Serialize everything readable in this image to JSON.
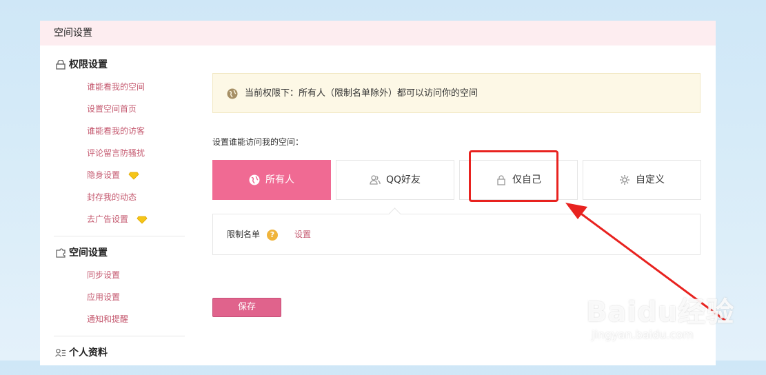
{
  "header": {
    "title": "空间设置"
  },
  "sidebar": {
    "groups": [
      {
        "title": "权限设置",
        "icon": "lock-icon",
        "items": [
          {
            "label": "谁能看我的空间"
          },
          {
            "label": "设置空间首页"
          },
          {
            "label": "谁能看我的访客"
          },
          {
            "label": "评论留言防骚扰"
          },
          {
            "label": "隐身设置",
            "badge_icon": "diamond-icon"
          },
          {
            "label": "封存我的动态"
          },
          {
            "label": "去广告设置",
            "badge_icon": "diamond-icon"
          }
        ]
      },
      {
        "title": "空间设置",
        "icon": "puzzle-icon",
        "items": [
          {
            "label": "同步设置"
          },
          {
            "label": "应用设置"
          },
          {
            "label": "通知和提醒"
          }
        ]
      },
      {
        "title": "个人资料",
        "icon": "profile-icon",
        "items": []
      }
    ]
  },
  "main": {
    "notice": "当前权限下：所有人（限制名单除外）都可以访问你的空间",
    "prompt": "设置谁能访问我的空间：",
    "options": [
      {
        "label": "所有人",
        "icon": "globe-icon",
        "selected": true
      },
      {
        "label": "QQ好友",
        "icon": "friends-icon",
        "selected": false
      },
      {
        "label": "仅自己",
        "icon": "lock-icon",
        "selected": false
      },
      {
        "label": "自定义",
        "icon": "gear-icon",
        "selected": false
      }
    ],
    "limit": {
      "label": "限制名单",
      "help": "?",
      "link": "设置"
    },
    "save_label": "保存"
  },
  "watermark": {
    "brand": "Baidu经验",
    "url": "jingyan.baidu.com"
  },
  "colors": {
    "accent": "#f06a93",
    "link": "#c55a70",
    "annotation": "#e8221f"
  }
}
